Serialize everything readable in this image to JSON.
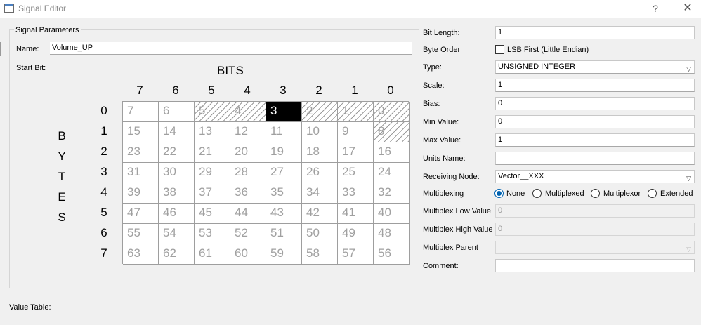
{
  "window": {
    "title": "Signal Editor",
    "help": "?",
    "close": "✕"
  },
  "signal_params": {
    "group_title": "Signal Parameters",
    "name_label": "Name:",
    "name_value": "Volume_UP",
    "start_bit_label": "Start Bit:",
    "bits_title": "BITS",
    "bytes_letters": [
      "B",
      "Y",
      "T",
      "E",
      "S"
    ],
    "col_headers": [
      "7",
      "6",
      "5",
      "4",
      "3",
      "2",
      "1",
      "0"
    ],
    "row_headers": [
      "0",
      "1",
      "2",
      "3",
      "4",
      "5",
      "6",
      "7"
    ],
    "grid": [
      [
        "7",
        "6",
        "5",
        "4",
        "3",
        "2",
        "1",
        "0"
      ],
      [
        "15",
        "14",
        "13",
        "12",
        "11",
        "10",
        "9",
        "8"
      ],
      [
        "23",
        "22",
        "21",
        "20",
        "19",
        "18",
        "17",
        "16"
      ],
      [
        "31",
        "30",
        "29",
        "28",
        "27",
        "26",
        "25",
        "24"
      ],
      [
        "39",
        "38",
        "37",
        "36",
        "35",
        "34",
        "33",
        "32"
      ],
      [
        "47",
        "46",
        "45",
        "44",
        "43",
        "42",
        "41",
        "40"
      ],
      [
        "55",
        "54",
        "53",
        "52",
        "51",
        "50",
        "49",
        "48"
      ],
      [
        "63",
        "62",
        "61",
        "60",
        "59",
        "58",
        "57",
        "56"
      ]
    ],
    "selected_bit": "3",
    "hatched_bits": [
      "5",
      "4",
      "2",
      "1",
      "0",
      "8"
    ]
  },
  "value_table_label": "Value Table:",
  "right": {
    "bit_length_label": "Bit Length:",
    "bit_length_value": "1",
    "byte_order_label": "Byte Order",
    "lsb_label": "LSB First (Little Endian)",
    "lsb_checked": false,
    "type_label": "Type:",
    "type_value": "UNSIGNED INTEGER",
    "scale_label": "Scale:",
    "scale_value": "1",
    "bias_label": "Bias:",
    "bias_value": "0",
    "min_label": "Min Value:",
    "min_value": "0",
    "max_label": "Max Value:",
    "max_value": "1",
    "units_label": "Units Name:",
    "units_value": "",
    "node_label": "Receiving Node:",
    "node_value": "Vector__XXX",
    "mux_label": "Multiplexing",
    "mux_options": [
      "None",
      "Multiplexed",
      "Multiplexor",
      "Extended"
    ],
    "mux_selected": "None",
    "mux_low_label": "Multiplex Low Value",
    "mux_low_value": "0",
    "mux_high_label": "Multiplex High Value",
    "mux_high_value": "0",
    "mux_parent_label": "Multiplex Parent",
    "mux_parent_value": "",
    "comment_label": "Comment:",
    "comment_value": ""
  }
}
